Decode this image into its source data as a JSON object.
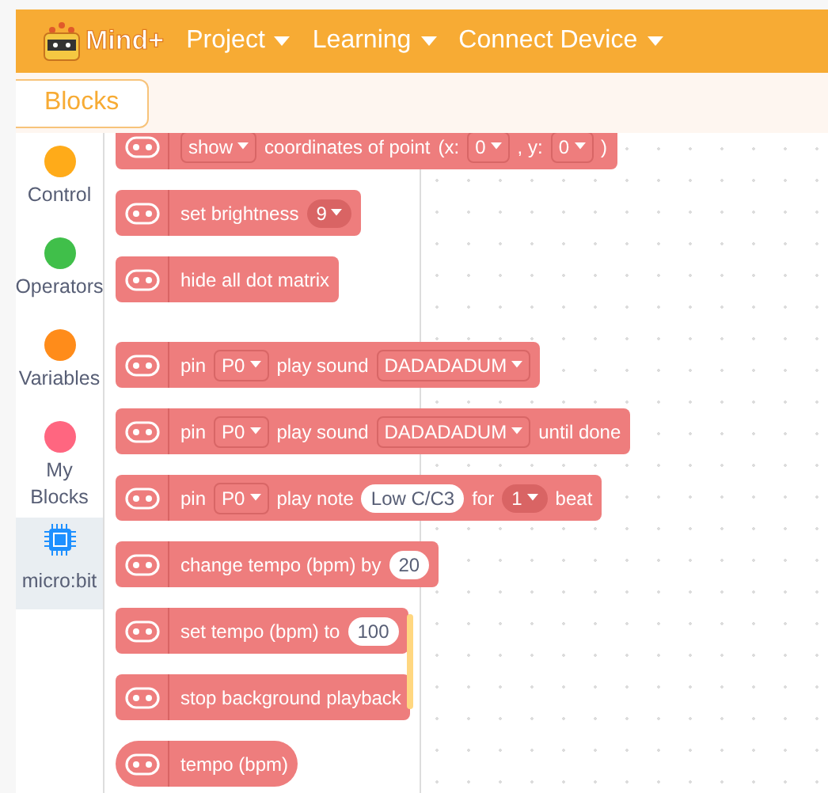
{
  "header": {
    "logo": "Mind+",
    "menus": [
      {
        "label": "Project"
      },
      {
        "label": "Learning"
      },
      {
        "label": "Connect Device"
      }
    ]
  },
  "tabs": [
    {
      "label": "Blocks",
      "selected": true
    }
  ],
  "categories": [
    {
      "label": "Control",
      "kind": "dot",
      "color": "#ffab19",
      "selected": false
    },
    {
      "label": "Operators",
      "kind": "dot",
      "color": "#40bf4a",
      "selected": false
    },
    {
      "label": "Variables",
      "kind": "dot",
      "color": "#ff8c1a",
      "selected": false
    },
    {
      "label": "My Blocks",
      "kind": "dot",
      "color": "#ff6680",
      "selected": false
    },
    {
      "label": "micro:bit",
      "kind": "chip",
      "color": "#1e90ff",
      "selected": true
    }
  ],
  "block_groups": [
    [
      {
        "kind": "stack",
        "parts": [
          {
            "kind": "dropdown",
            "text": "show"
          },
          {
            "kind": "text",
            "text": "coordinates of point"
          },
          {
            "kind": "text",
            "text": "(x:"
          },
          {
            "kind": "dropdown",
            "text": "0"
          },
          {
            "kind": "text",
            "text": ", y:"
          },
          {
            "kind": "dropdown",
            "text": "0"
          },
          {
            "kind": "text",
            "text": ")"
          }
        ]
      },
      {
        "kind": "stack",
        "parts": [
          {
            "kind": "text",
            "text": "set brightness"
          },
          {
            "kind": "round",
            "text": "9"
          }
        ]
      },
      {
        "kind": "stack",
        "parts": [
          {
            "kind": "text",
            "text": "hide all dot matrix"
          }
        ]
      }
    ],
    [
      {
        "kind": "stack",
        "parts": [
          {
            "kind": "text",
            "text": "pin"
          },
          {
            "kind": "dropdown",
            "text": "P0"
          },
          {
            "kind": "text",
            "text": "play sound"
          },
          {
            "kind": "dropdown",
            "text": "DADADADUM"
          }
        ]
      },
      {
        "kind": "stack",
        "parts": [
          {
            "kind": "text",
            "text": "pin"
          },
          {
            "kind": "dropdown",
            "text": "P0"
          },
          {
            "kind": "text",
            "text": "play sound"
          },
          {
            "kind": "dropdown",
            "text": "DADADADUM"
          },
          {
            "kind": "text",
            "text": "until done"
          }
        ]
      },
      {
        "kind": "stack",
        "parts": [
          {
            "kind": "text",
            "text": "pin"
          },
          {
            "kind": "dropdown",
            "text": "P0"
          },
          {
            "kind": "text",
            "text": "play note"
          },
          {
            "kind": "input",
            "text": "Low C/C3"
          },
          {
            "kind": "text",
            "text": "for"
          },
          {
            "kind": "round",
            "text": "1"
          },
          {
            "kind": "text",
            "text": "beat"
          }
        ]
      },
      {
        "kind": "stack",
        "parts": [
          {
            "kind": "text",
            "text": "change tempo (bpm) by"
          },
          {
            "kind": "input",
            "text": "20"
          }
        ]
      },
      {
        "kind": "stack",
        "parts": [
          {
            "kind": "text",
            "text": "set tempo (bpm) to"
          },
          {
            "kind": "input",
            "text": "100"
          }
        ]
      },
      {
        "kind": "stack",
        "parts": [
          {
            "kind": "text",
            "text": "stop background playback"
          }
        ]
      },
      {
        "kind": "reporter",
        "parts": [
          {
            "kind": "text",
            "text": "tempo (bpm)"
          }
        ]
      }
    ]
  ]
}
